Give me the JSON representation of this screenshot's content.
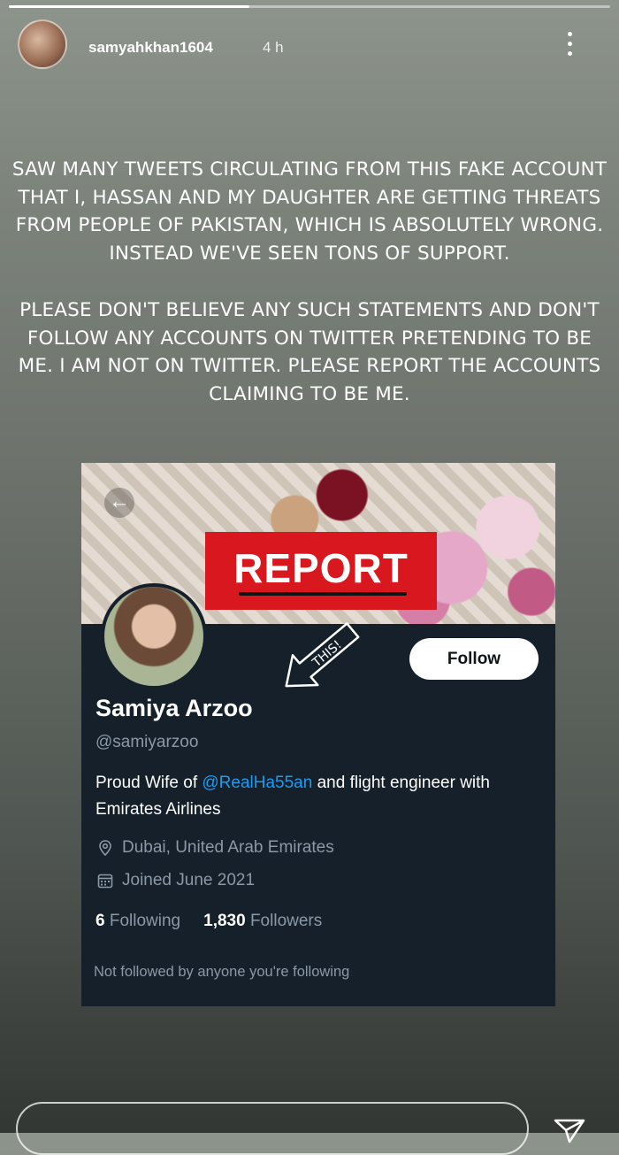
{
  "story": {
    "progress": 0.4,
    "username": "samyahkhan1604",
    "time": "4 h"
  },
  "statement": {
    "paragraph1": "SAW MANY TWEETS CIRCULATING FROM THIS FAKE ACCOUNT THAT I, HASSAN AND MY DAUGHTER ARE GETTING THREATS FROM PEOPLE OF PAKISTAN, WHICH IS ABSOLUTELY WRONG. INSTEAD WE'VE SEEN TONS OF SUPPORT.",
    "paragraph2": "PLEASE DON'T BELIEVE ANY SUCH STATEMENTS AND DON'T FOLLOW ANY ACCOUNTS ON TWITTER PRETENDING TO BE ME. I AM NOT ON TWITTER. PLEASE REPORT THE ACCOUNTS CLAIMING TO BE ME."
  },
  "twitter_profile": {
    "report_label": "REPORT",
    "annotation": "THIS!",
    "follow_label": "Follow",
    "display_name": "Samiya Arzoo",
    "handle": "@samiyarzoo",
    "bio_prefix": "Proud Wife of ",
    "bio_mention": "@RealHa55an",
    "bio_suffix": " and flight engineer with Emirates Airlines",
    "location": "Dubai, United Arab Emirates",
    "joined": "Joined June 2021",
    "following_count": "6",
    "following_label": "Following",
    "followers_count": "1,830",
    "followers_label": "Followers",
    "not_followed": "Not followed by anyone you're following"
  },
  "icons": {
    "more": "more-vertical-icon",
    "back": "arrow-left-icon",
    "location": "location-pin-icon",
    "calendar": "calendar-icon",
    "send": "send-icon"
  },
  "colors": {
    "twitter_bg": "#15202b",
    "twitter_blue": "#1d9bf0",
    "report_red": "#d8171e"
  }
}
